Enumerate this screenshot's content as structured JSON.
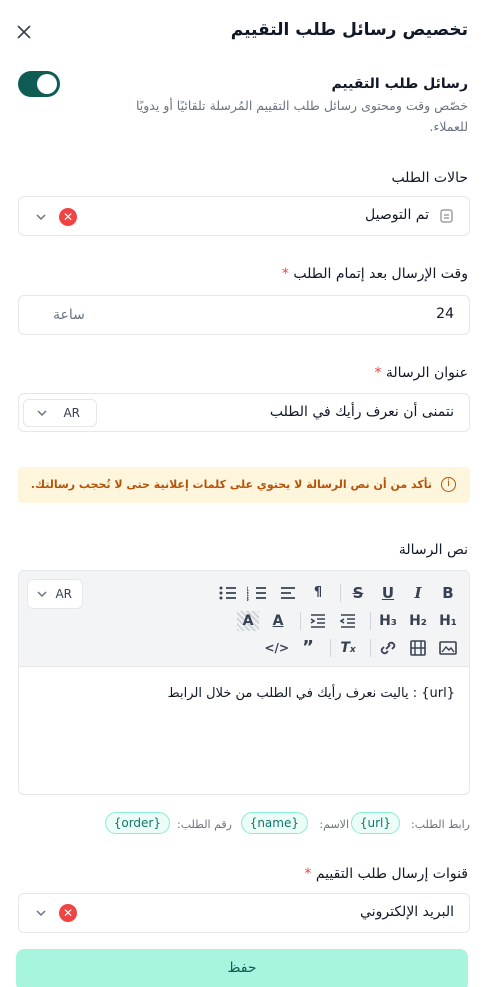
{
  "header": {
    "title": "تخصيص رسائل طلب التقييم"
  },
  "toggle_section": {
    "title": "رسائل طلب التقييم",
    "description_line1": "خصّص وقت ومحتوى رسائل طلب التقييم المُرسلة تلقائيًا أو يدويًا",
    "description_line2": "للعملاء.",
    "enabled": true
  },
  "order_status": {
    "label": "حالات الطلب",
    "value": "تم التوصيل"
  },
  "send_time": {
    "label": "وقت الإرسال بعد إتمام الطلب",
    "required_mark": "*",
    "value": "24",
    "unit": "ساعة"
  },
  "subject": {
    "label": "عنوان الرسالة",
    "required_mark": "*",
    "value": "نتمنى أن نعرف رأيك في الطلب",
    "lang": "AR"
  },
  "alert": {
    "text": "تأكد من أن نص الرسالة لا يحتوي على كلمات إعلانية حتى لا تُحجب رسالتك."
  },
  "body": {
    "label": "نص الرسالة",
    "lang": "AR",
    "content": "{url} : ياليت نعرف رأيك في الطلب من خلال الرابط"
  },
  "variables": {
    "url_label": "رابط الطلب:",
    "url_token": "{url}",
    "name_label": "الاسم:",
    "name_token": "{name}",
    "order_label": "رقم الطلب:",
    "order_token": "{order}"
  },
  "channels": {
    "label": "قنوات إرسال طلب التقييم",
    "required_mark": "*",
    "value": "البريد الإلكتروني"
  },
  "footer": {
    "save_label": "حفظ"
  },
  "colors": {
    "accent": "#0f5c55",
    "save_bg": "#a7f5df",
    "alert_bg": "#fef6dc",
    "danger": "#ef4444"
  }
}
